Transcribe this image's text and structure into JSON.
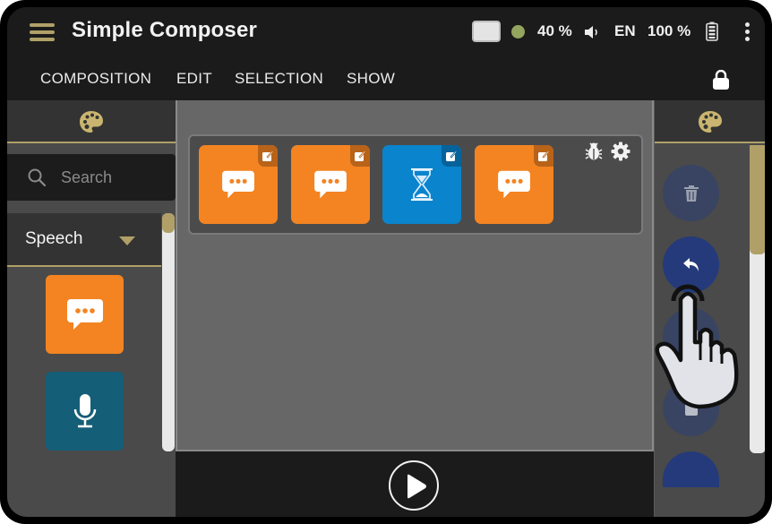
{
  "app": {
    "title": "Simple Composer",
    "menu_icon": "hamburger-menu-icon"
  },
  "status_bar": {
    "screen_icon": "screen-icon",
    "connection_color": "#93a55e",
    "volume": "40 %",
    "volume_icon": "speaker-icon",
    "language": "EN",
    "battery": "100 %",
    "battery_icon": "battery-full-icon",
    "more_icon": "more-vert-icon"
  },
  "menubar": {
    "items": [
      {
        "label": "COMPOSITION"
      },
      {
        "label": "EDIT"
      },
      {
        "label": "SELECTION"
      },
      {
        "label": "SHOW"
      }
    ],
    "lock_icon": "lock-icon"
  },
  "left_panel": {
    "tab_icon": "palette-icon",
    "search": {
      "placeholder": "Search",
      "value": ""
    },
    "category": {
      "selected": "Speech"
    },
    "blocks": [
      {
        "icon": "speech-bubble-icon",
        "color": "#f38421"
      },
      {
        "icon": "microphone-icon",
        "color": "#155e78"
      }
    ]
  },
  "canvas": {
    "sequence": {
      "blocks": [
        {
          "icon": "speech-bubble-icon",
          "color": "#f38421",
          "badge": "edit-icon"
        },
        {
          "icon": "speech-bubble-icon",
          "color": "#f38421",
          "badge": "edit-icon"
        },
        {
          "icon": "hourglass-icon",
          "color": "#0a84cc",
          "badge": "edit-icon"
        },
        {
          "icon": "speech-bubble-icon",
          "color": "#f38421",
          "badge": "edit-icon"
        }
      ],
      "tools": [
        "bug-icon",
        "gear-icon"
      ]
    }
  },
  "playbar": {
    "play_icon": "play-icon"
  },
  "right_panel": {
    "tab_icon": "palette-icon",
    "actions": [
      {
        "icon": "trash-icon",
        "enabled": false
      },
      {
        "icon": "undo-icon",
        "enabled": true
      },
      {
        "icon": "copy-icon",
        "enabled": false
      },
      {
        "icon": "paste-icon",
        "enabled": false
      },
      {
        "icon": "more-action-icon",
        "enabled": true
      }
    ]
  },
  "colors": {
    "accent": "#b0a068",
    "speech": "#f38421",
    "wait": "#0a84cc",
    "listen": "#155e78",
    "fab_active": "#243a7a"
  }
}
